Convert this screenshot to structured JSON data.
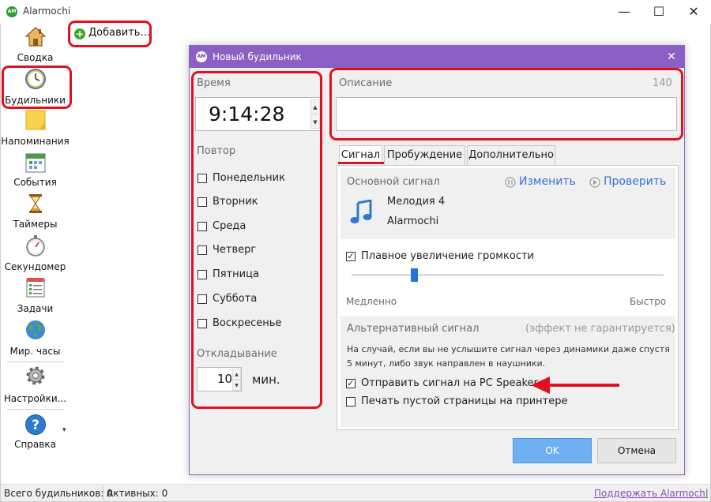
{
  "window": {
    "logo_text": "AM",
    "title": "Alarmochi",
    "minimize_glyph": "—",
    "maximize_glyph": "☐",
    "close_glyph": "✕"
  },
  "sidebar": {
    "items": [
      {
        "label": "Сводка",
        "icon": "house-icon"
      },
      {
        "label": "Будильники",
        "icon": "clock-icon"
      },
      {
        "label": "Напоминания",
        "icon": "sticky-note-icon"
      },
      {
        "label": "События",
        "icon": "calendar-icon"
      },
      {
        "label": "Таймеры",
        "icon": "hourglass-icon"
      },
      {
        "label": "Секундомер",
        "icon": "stopwatch-icon"
      },
      {
        "label": "Задачи",
        "icon": "task-list-icon"
      },
      {
        "label": "Мир. часы",
        "icon": "globe-icon"
      },
      {
        "label": "Настройки...",
        "icon": "gear-icon"
      },
      {
        "label": "Справка",
        "icon": "help-icon"
      }
    ],
    "help_arrow": "▾"
  },
  "toolbar": {
    "add_label": "Добавить...",
    "add_icon": "plus-icon",
    "add_glyph": "+"
  },
  "dialog": {
    "logo_text": "AM",
    "title": "Новый будильник",
    "close_glyph": "✕",
    "time_section": {
      "label": "Время",
      "value": "9:14:28",
      "up_glyph": "▲",
      "down_glyph": "▼"
    },
    "repeat_section": {
      "label": "Повтор",
      "days": [
        {
          "label": "Понедельник",
          "checked": false
        },
        {
          "label": "Вторник",
          "checked": false
        },
        {
          "label": "Среда",
          "checked": false
        },
        {
          "label": "Четверг",
          "checked": false
        },
        {
          "label": "Пятница",
          "checked": false
        },
        {
          "label": "Суббота",
          "checked": false
        },
        {
          "label": "Воскресенье",
          "checked": false
        }
      ]
    },
    "snooze_section": {
      "label": "Откладывание",
      "value": "10",
      "unit": "мин."
    },
    "description_section": {
      "label": "Описание",
      "counter": "140",
      "value": ""
    },
    "tabs": [
      {
        "label": "Сигнал",
        "active": true
      },
      {
        "label": "Пробуждение",
        "active": false
      },
      {
        "label": "Дополнительно",
        "active": false
      }
    ],
    "signal_tab": {
      "main_signal_label": "Основной сигнал",
      "change_label": "Изменить",
      "check_label": "Проверить",
      "melody_name": "Мелодия 4",
      "melody_source": "Alarmochi",
      "smooth_volume_label": "Плавное увеличение громкости",
      "smooth_volume_checked": true,
      "speed_slider_value": 0.2,
      "slow_label": "Медленно",
      "fast_label": "Быстро",
      "alt_signal_label": "Альтернативный сигнал",
      "alt_signal_note": "(эффект не гарантируется)",
      "alt_signal_desc": "На случай, если вы не услышите сигнал через динамики даже спустя 5 минут, либо звук направлен в наушники.",
      "pc_speaker_label": "Отправить сигнал на PC Speaker",
      "pc_speaker_checked": true,
      "print_label": "Печать пустой страницы на принтере",
      "print_checked": false
    },
    "ok_label": "OK",
    "cancel_label": "Отмена",
    "check_glyph": "✓"
  },
  "statusbar": {
    "total_label": "Всего будильников: 0",
    "active_label": "Активных: 0",
    "support_link": "Поддержать Alarmochi"
  },
  "colors": {
    "dialog_title_bg": "#8b5fc3",
    "annotation_red": "#e11020",
    "link_blue": "#3a6fd8",
    "ok_button": "#6fb0f2"
  }
}
